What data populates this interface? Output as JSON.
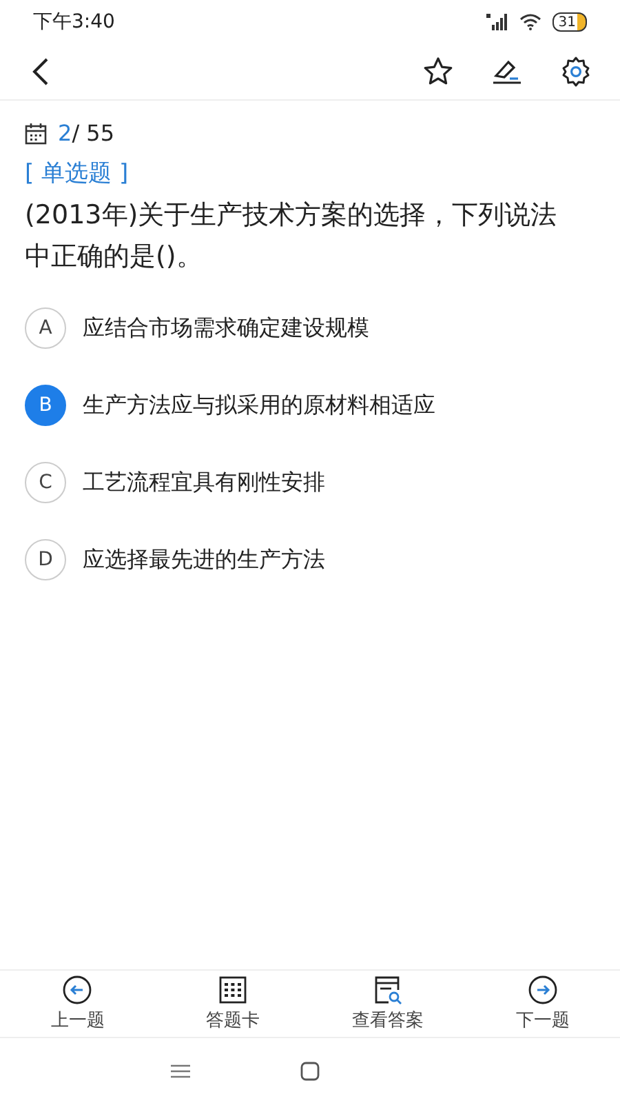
{
  "status_bar": {
    "time": "下午3:40",
    "battery": "31"
  },
  "progress": {
    "current": "2",
    "total": "/ 55"
  },
  "question": {
    "type": "[ 单选题 ]",
    "text": "(2013年)关于生产技术方案的选择，下列说法中正确的是()。"
  },
  "options": [
    {
      "letter": "A",
      "text": "应结合市场需求确定建设规模",
      "selected": false
    },
    {
      "letter": "B",
      "text": "生产方法应与拟采用的原材料相适应",
      "selected": true
    },
    {
      "letter": "C",
      "text": "工艺流程宜具有刚性安排",
      "selected": false
    },
    {
      "letter": "D",
      "text": "应选择最先进的生产方法",
      "selected": false
    }
  ],
  "bottom_bar": [
    {
      "label": "上一题",
      "kind": "prev"
    },
    {
      "label": "答题卡",
      "kind": "card"
    },
    {
      "label": "查看答案",
      "kind": "answer"
    },
    {
      "label": "下一题",
      "kind": "next"
    }
  ]
}
